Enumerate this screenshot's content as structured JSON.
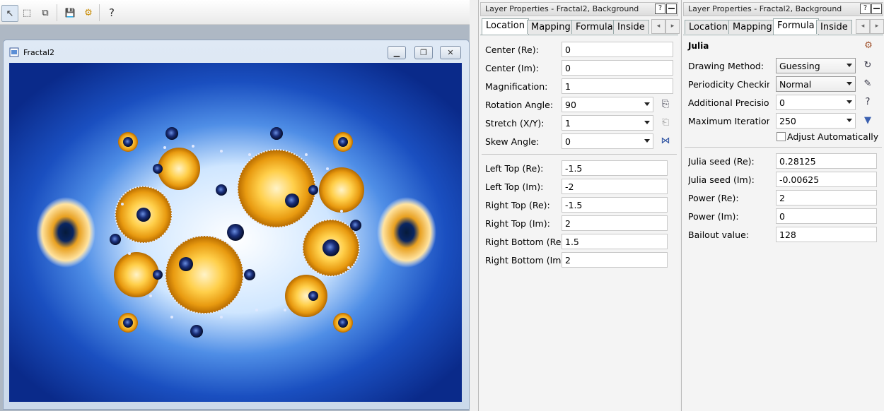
{
  "toolbar": {
    "buttons": [
      {
        "name": "select-tool",
        "glyph": "↖"
      },
      {
        "name": "marquee-tool",
        "glyph": "⬚"
      },
      {
        "name": "layers-tool",
        "glyph": "⧉"
      },
      {
        "name": "save",
        "glyph": "💾"
      },
      {
        "name": "settings",
        "glyph": "⚙"
      },
      {
        "name": "help",
        "glyph": "?"
      }
    ]
  },
  "document": {
    "title": "Fractal2",
    "minimize": "▁",
    "restore": "❐",
    "close": "✕"
  },
  "panel1": {
    "title": "Layer Properties - Fractal2, Background",
    "help": "?",
    "tabs": [
      "Location",
      "Mapping",
      "Formula",
      "Inside"
    ],
    "active_tab": "Location",
    "arrows": [
      "◂",
      "▸"
    ],
    "fields": [
      {
        "label": "Center (Re):",
        "value": "0",
        "type": "text"
      },
      {
        "label": "Center (Im):",
        "value": "0",
        "type": "text"
      },
      {
        "label": "Magnification:",
        "value": "1",
        "type": "text"
      },
      {
        "label": "Rotation Angle:",
        "value": "90",
        "type": "combo"
      },
      {
        "label": "Stretch (X/Y):",
        "value": "1",
        "type": "combo"
      },
      {
        "label": "Skew Angle:",
        "value": "0",
        "type": "combo"
      }
    ],
    "corners": [
      {
        "label": "Left Top (Re):",
        "value": "-1.5"
      },
      {
        "label": "Left Top (Im):",
        "value": "-2"
      },
      {
        "label": "Right Top (Re):",
        "value": "-1.5"
      },
      {
        "label": "Right Top (Im):",
        "value": "2"
      },
      {
        "label": "Right Bottom (Re)",
        "value": "1.5"
      },
      {
        "label": "Right Bottom (Im)",
        "value": "2"
      }
    ]
  },
  "panel2": {
    "title": "Layer Properties - Fractal2, Background",
    "help": "?",
    "tabs": [
      "Location",
      "Mapping",
      "Formula",
      "Inside"
    ],
    "active_tab": "Formula",
    "arrows": [
      "◂",
      "▸"
    ],
    "formula_name": "Julia",
    "fields": [
      {
        "label": "Drawing Method:",
        "value": "Guessing",
        "type": "select"
      },
      {
        "label": "Periodicity Checking",
        "value": "Normal",
        "type": "select"
      },
      {
        "label": "Additional Precision",
        "value": "0",
        "type": "combo"
      },
      {
        "label": "Maximum Iterations",
        "value": "250",
        "type": "combo"
      }
    ],
    "help_glyph": "?",
    "adjust_label": "Adjust Automatically",
    "params": [
      {
        "label": "Julia seed (Re):",
        "value": "0.28125"
      },
      {
        "label": "Julia seed (Im):",
        "value": "-0.00625"
      },
      {
        "label": "Power (Re):",
        "value": "2"
      },
      {
        "label": "Power (Im):",
        "value": "0"
      },
      {
        "label": "Bailout value:",
        "value": "128"
      }
    ]
  }
}
